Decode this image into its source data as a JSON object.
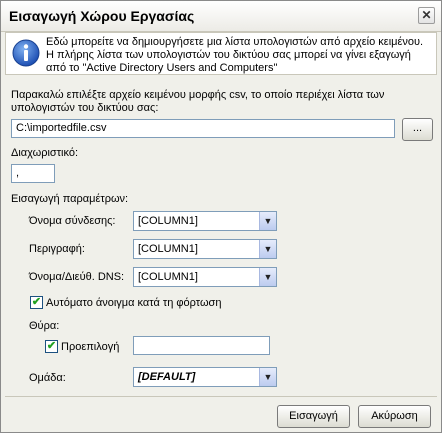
{
  "window": {
    "title": "Εισαγωγή Χώρου Εργασίας",
    "close_label": "✕"
  },
  "info": {
    "icon": "info-icon",
    "text": "Εδώ μπορείτε να δημιουργήσετε μια λίστα υπολογιστών από αρχείο κειμένου. Η πλήρης λίστα των υπολογιστών του δικτύου σας μπορεί να γίνει εξαγωγή από το \"Active Directory Users and Computers\""
  },
  "file": {
    "prompt": "Παρακαλώ επιλέξτε αρχείο κειμένου μορφής csv, το οποίο περιέχει λίστα των υπολογιστών του δικτύου σας:",
    "path": "C:\\importedfile.csv",
    "browse_label": "..."
  },
  "separator": {
    "label": "Διαχωριστικό:",
    "value": ","
  },
  "params": {
    "heading": "Εισαγωγή παραμέτρων:",
    "login_label": "Όνομα σύνδεσης:",
    "login_value": "[COLUMN1]",
    "description_label": "Περιγραφή:",
    "description_value": "[COLUMN1]",
    "dns_label": "Όνομα/Διεύθ. DNS:",
    "dns_value": "[COLUMN1]"
  },
  "autoopen": {
    "label": "Αυτόματο άνοιγμα κατά τη φόρτωση",
    "checked": true
  },
  "port": {
    "label": "Θύρα:",
    "default_label": "Προεπιλογή",
    "default_checked": true,
    "value": ""
  },
  "group": {
    "label": "Ομάδα:",
    "value": "[DEFAULT]"
  },
  "buttons": {
    "import_label": "Εισαγωγή",
    "cancel_label": "Ακύρωση"
  }
}
